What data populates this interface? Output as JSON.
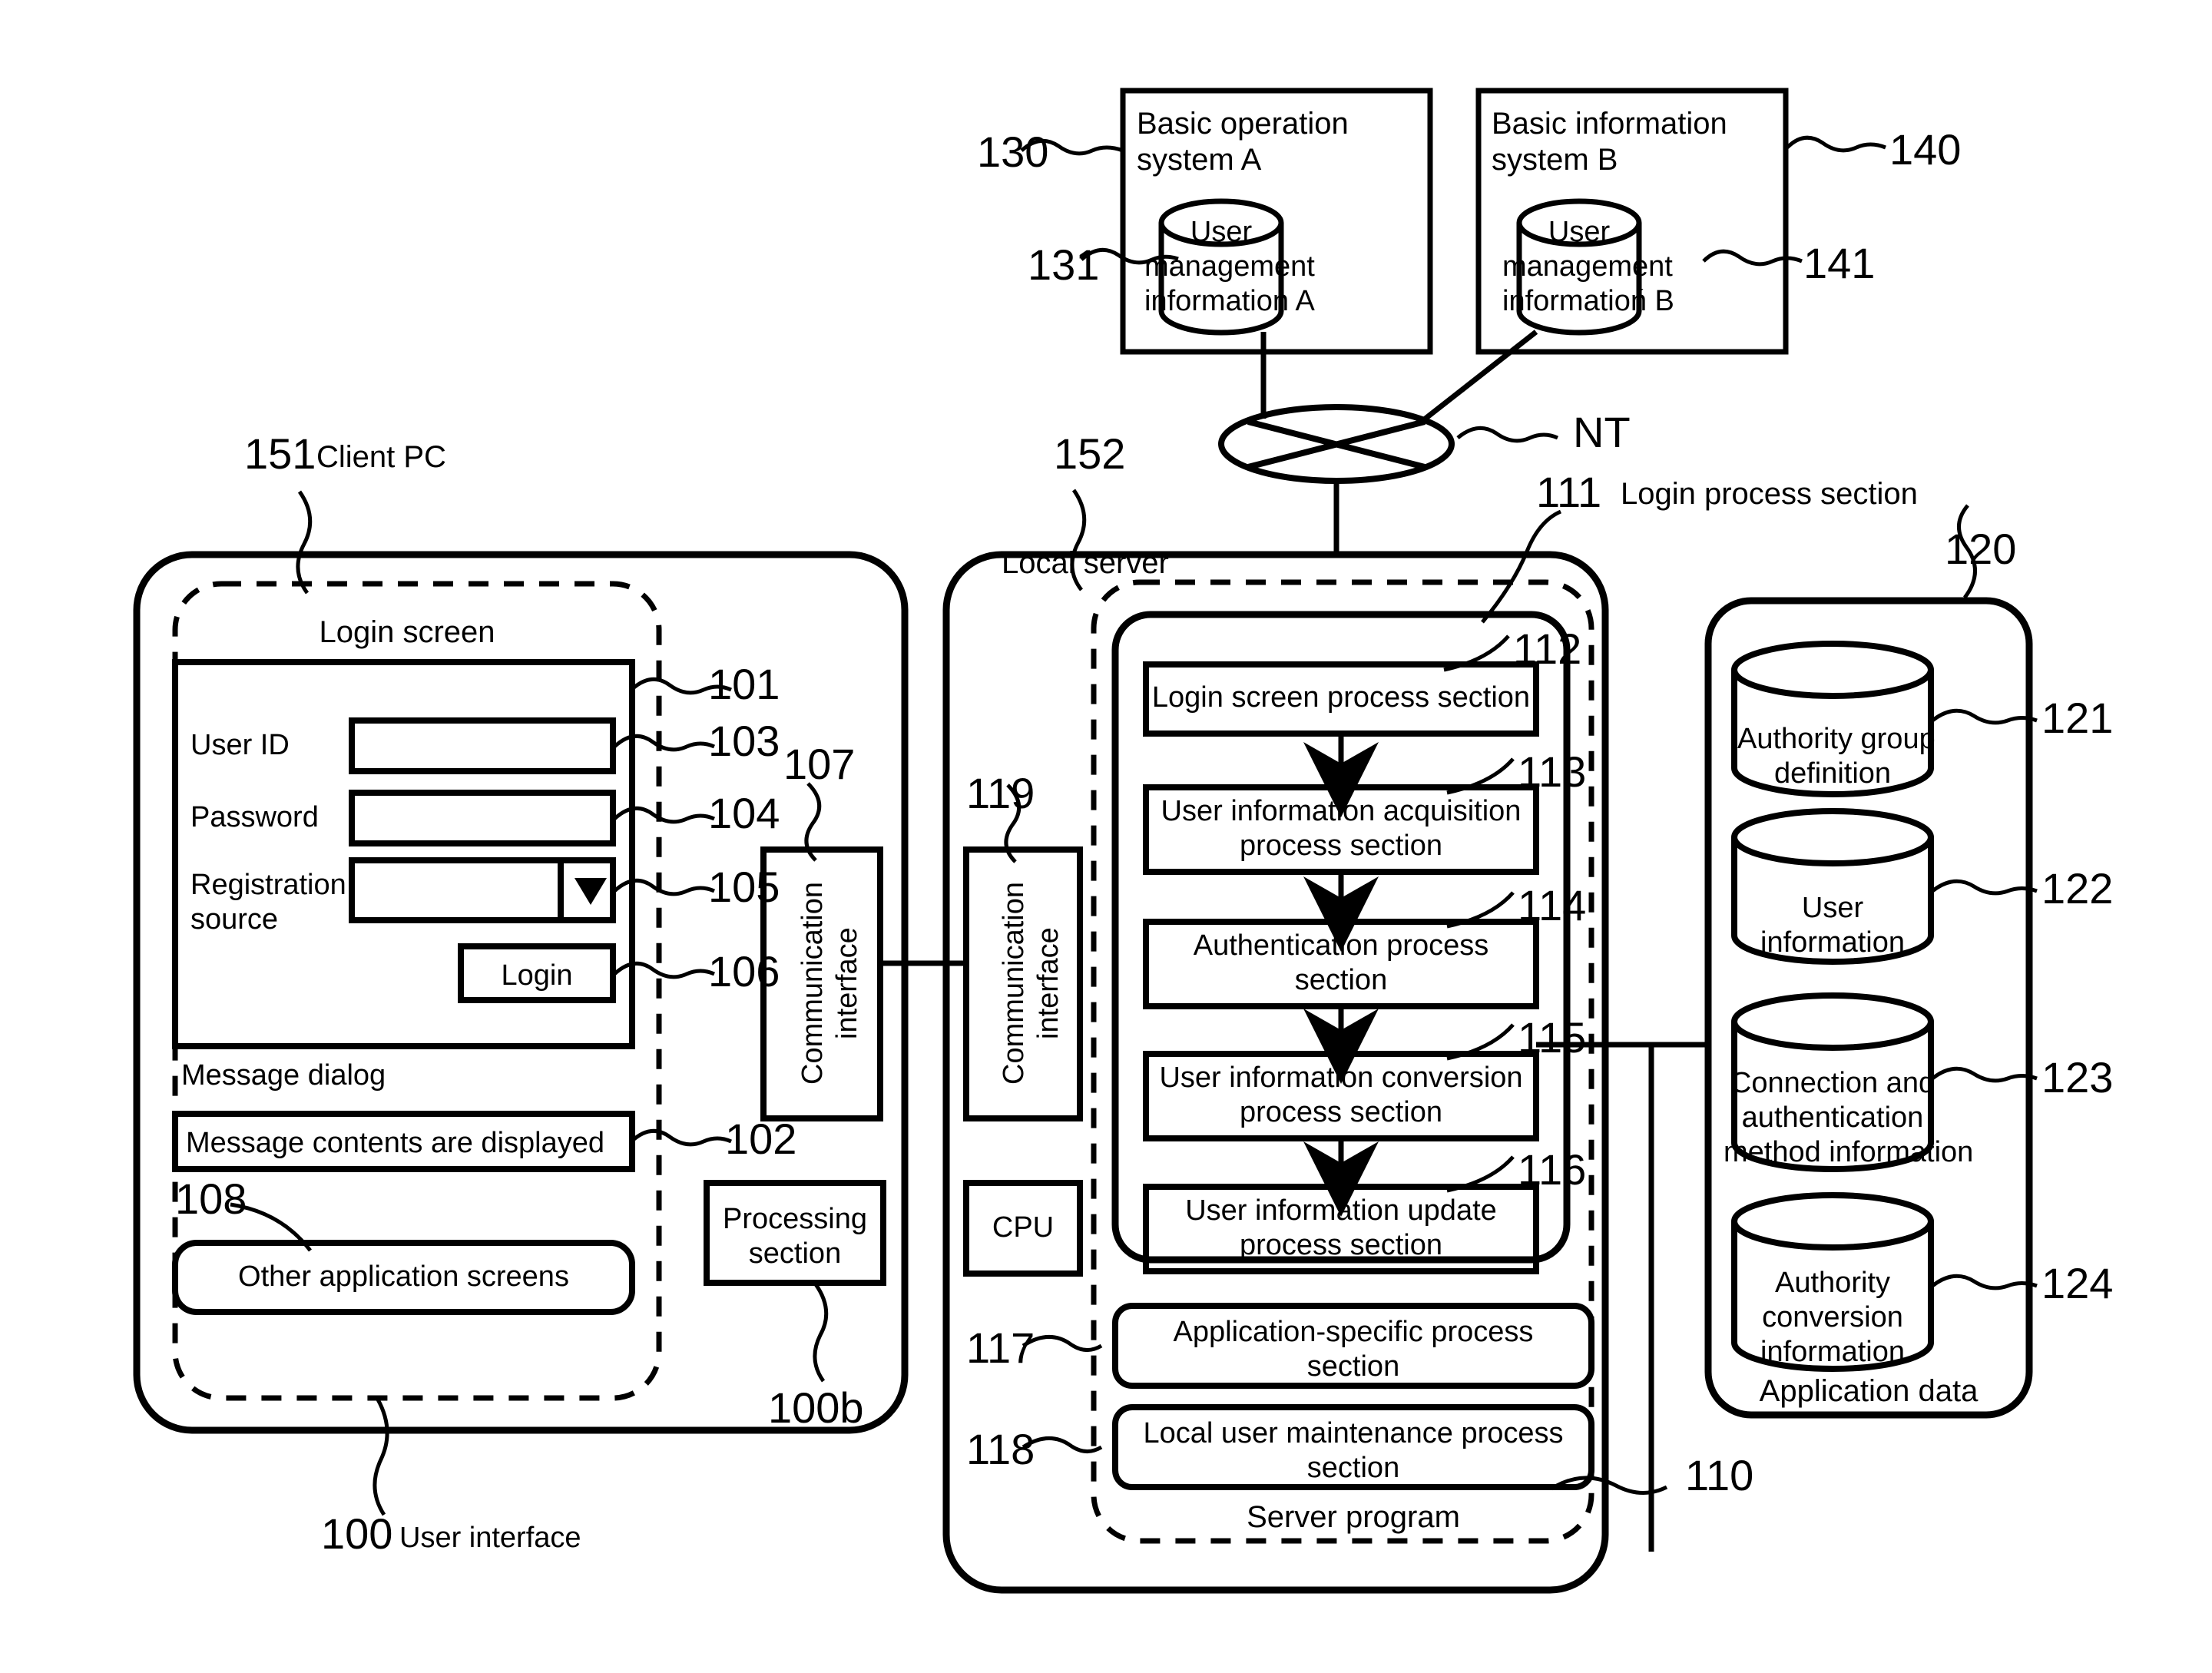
{
  "diagram": {
    "top_systems": [
      {
        "ref": "130",
        "title": "Basic operation\nsystem A",
        "db_ref": "131",
        "db_label": "User\nmanagement\ninformation A"
      },
      {
        "ref": "140",
        "title": "Basic information\nsystem B",
        "db_ref": "141",
        "db_label": "User\nmanagement\ninformatioń B"
      }
    ],
    "network": {
      "label": "NT"
    },
    "client": {
      "ref": "151",
      "title": "Client PC",
      "ui_ref": "100",
      "ui_label": "User interface",
      "processing_ref": "100b",
      "login_screen_label": "Login screen",
      "login_panel_ref": "101",
      "fields": [
        {
          "label": "User ID",
          "ref": "103",
          "type": "text"
        },
        {
          "label": "Password",
          "ref": "104",
          "type": "text"
        },
        {
          "label": "Registration\nsource",
          "ref": "105",
          "type": "dropdown"
        }
      ],
      "login_button": {
        "label": "Login",
        "ref": "106"
      },
      "message_dialog_label": "Message dialog",
      "message_box": {
        "text": "Message contents are displayed",
        "ref": "102"
      },
      "other_screens": {
        "text": "Other application screens",
        "ref": "108"
      },
      "comm_interface": {
        "label": "Communication\ninterface",
        "ref": "107"
      },
      "processing_section": {
        "label": "Processing\nsection"
      }
    },
    "server": {
      "ref": "152",
      "title": "Local server",
      "program_ref": "110",
      "program_label": "Server program",
      "comm_interface": {
        "label": "Communication\ninterface",
        "ref": "119"
      },
      "cpu_label": "CPU",
      "login_process": {
        "ref": "111",
        "label": "Login process section"
      },
      "steps": [
        {
          "ref": "112",
          "label": "Login screen process section"
        },
        {
          "ref": "113",
          "label": "User information acquisition\nprocess section"
        },
        {
          "ref": "114",
          "label": "Authentication process\nsection"
        },
        {
          "ref": "115",
          "label": "User information conversion\nprocess section"
        },
        {
          "ref": "116",
          "label": "User information update\nprocess section"
        }
      ],
      "extra_sections": [
        {
          "ref": "117",
          "label": "Application-specific process\nsection"
        },
        {
          "ref": "118",
          "label": "Local user maintenance process\nsection"
        }
      ]
    },
    "app_data": {
      "ref": "120",
      "label": "Application data",
      "stores": [
        {
          "ref": "121",
          "label": "Authority group\ndefinition"
        },
        {
          "ref": "122",
          "label": "User\ninformation"
        },
        {
          "ref": "123",
          "label": "Connection and\nauthentication\nmethod information"
        },
        {
          "ref": "124",
          "label": "Authority\nconversion\ninformation"
        }
      ]
    }
  }
}
